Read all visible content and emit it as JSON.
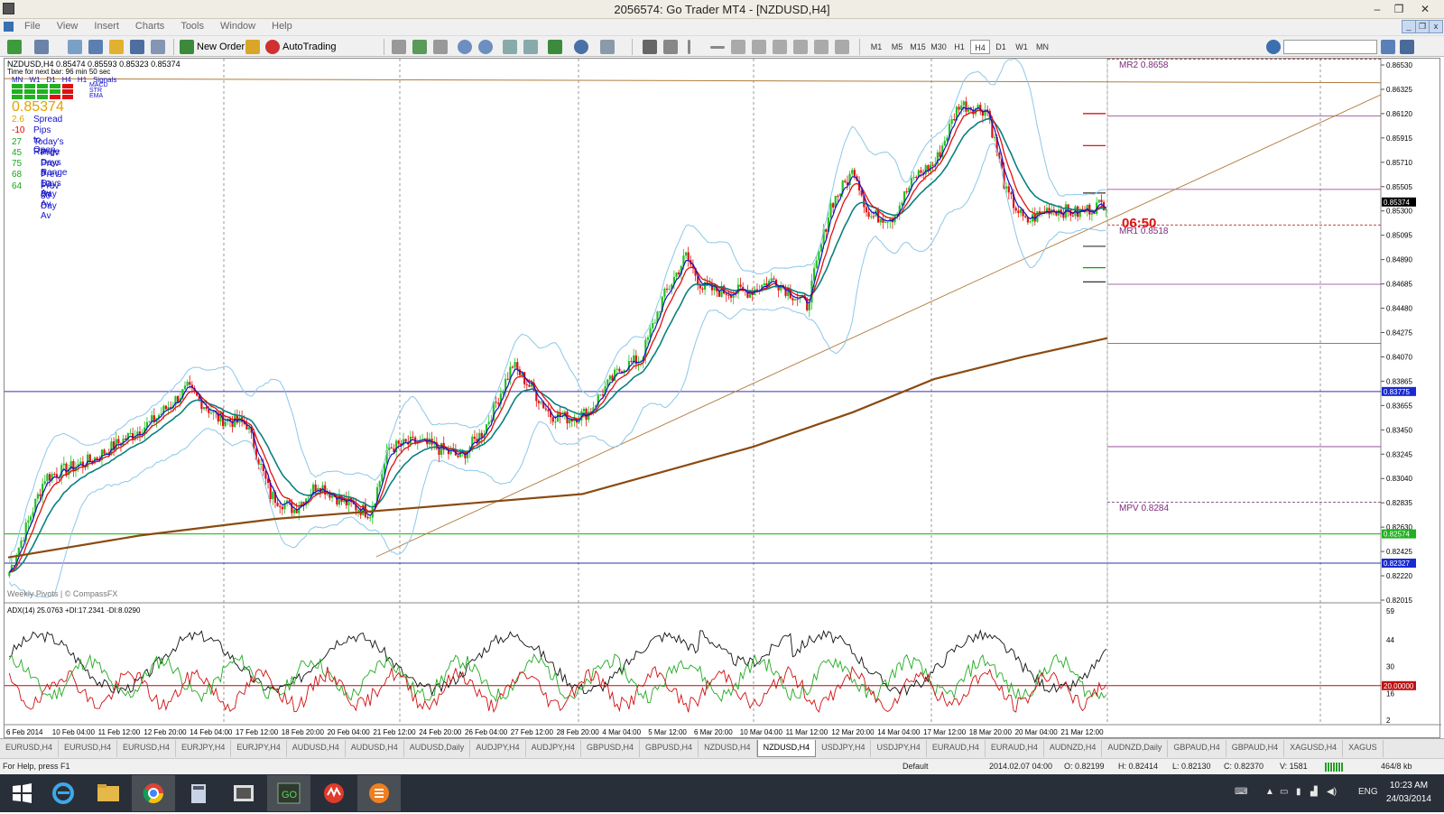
{
  "window": {
    "title": "2056574: Go Trader MT4 - [NZDUSD,H4]"
  },
  "menu": [
    "File",
    "View",
    "Insert",
    "Charts",
    "Tools",
    "Window",
    "Help"
  ],
  "toolbar": {
    "new_order": "New Order",
    "autotrading": "AutoTrading",
    "timeframes": [
      "M1",
      "M5",
      "M15",
      "M30",
      "H1",
      "H4",
      "D1",
      "W1",
      "MN"
    ],
    "active_timeframe": "H4"
  },
  "chart": {
    "symbol_line": "NZDUSD,H4  0.85474 0.85593 0.85323 0.85374",
    "time_to_bar": "Time for next bar: 96 min 50 sec",
    "signals_header": [
      "MN",
      "W1",
      "D1",
      "H4",
      "H1",
      "Signals"
    ],
    "signal_rows": [
      "MACD",
      "STR",
      "EMA"
    ],
    "price": "0.85374",
    "stats": [
      {
        "value": "2.6",
        "label": "Spread",
        "vcolor": "#e3a200",
        "lcolor": "#1414c8"
      },
      {
        "value": "-10",
        "label": "Pips to Open",
        "vcolor": "#e00000",
        "lcolor": "#1414c8"
      },
      {
        "value": "27",
        "label": "Today's Range",
        "vcolor": "#18a818",
        "lcolor": "#1414c8"
      },
      {
        "value": "45",
        "label": "Prev Days Range",
        "vcolor": "#18a818",
        "lcolor": "#1414c8"
      },
      {
        "value": "75",
        "label": "Prev 5 Days Av",
        "vcolor": "#18a818",
        "lcolor": "#1414c8"
      },
      {
        "value": "68",
        "label": "Prev 10 Day Av",
        "vcolor": "#18a818",
        "lcolor": "#1414c8"
      },
      {
        "value": "64",
        "label": "Prev 30 Day Av",
        "vcolor": "#18a818",
        "lcolor": "#1414c8"
      }
    ],
    "pivot_labels": {
      "mr2": "MR2  0.8658",
      "mr1": "MR1  0.8518",
      "mpv": "MPV  0.8284"
    },
    "countdown": "06:50",
    "watermark": "Weekly Pivots | © CompassFX",
    "price_ticks": [
      "0.86530",
      "0.86325",
      "0.86120",
      "0.85915",
      "0.85710",
      "0.85505",
      "0.85300",
      "0.85095",
      "0.84890",
      "0.84685",
      "0.84480",
      "0.84275",
      "0.84070",
      "0.83865",
      "0.83655",
      "0.83450",
      "0.83245",
      "0.83040",
      "0.82835",
      "0.82630",
      "0.82425",
      "0.82220",
      "0.82015"
    ],
    "price_tags": [
      {
        "text": "0.85374",
        "bg": "#000000",
        "value": 0.85374
      },
      {
        "text": "0.83775",
        "bg": "#1a2ad0",
        "value": 0.83775
      },
      {
        "text": "0.82574",
        "bg": "#22b022",
        "value": 0.82574
      },
      {
        "text": "0.82327",
        "bg": "#1a2ad0",
        "value": 0.82327
      }
    ],
    "adx_label": "ADX(14) 25.0763 +DI:17.2341 -DI:8.0290",
    "adx_ticks": [
      "59",
      "44",
      "30",
      "16",
      "2"
    ],
    "adx_tag": "20.00000",
    "time_ticks": [
      "6 Feb 2014",
      "10 Feb 04:00",
      "11 Feb 12:00",
      "12 Feb 20:00",
      "14 Feb 04:00",
      "17 Feb 12:00",
      "18 Feb 20:00",
      "20 Feb 04:00",
      "21 Feb 12:00",
      "24 Feb 20:00",
      "26 Feb 04:00",
      "27 Feb 12:00",
      "28 Feb 20:00",
      "4 Mar 04:00",
      "5 Mar 12:00",
      "6 Mar 20:00",
      "10 Mar 04:00",
      "11 Mar 12:00",
      "12 Mar 20:00",
      "14 Mar 04:00",
      "17 Mar 12:00",
      "18 Mar 20:00",
      "20 Mar 04:00",
      "21 Mar 12:00"
    ]
  },
  "tabs": [
    {
      "label": "EURUSD,H4"
    },
    {
      "label": "EURUSD,H4"
    },
    {
      "label": "EURUSD,H4"
    },
    {
      "label": "EURJPY,H4"
    },
    {
      "label": "EURJPY,H4"
    },
    {
      "label": "AUDUSD,H4"
    },
    {
      "label": "AUDUSD,H4"
    },
    {
      "label": "AUDUSD,Daily"
    },
    {
      "label": "AUDJPY,H4"
    },
    {
      "label": "AUDJPY,H4"
    },
    {
      "label": "GBPUSD,H4"
    },
    {
      "label": "GBPUSD,H4"
    },
    {
      "label": "NZDUSD,H4"
    },
    {
      "label": "NZDUSD,H4",
      "active": true
    },
    {
      "label": "USDJPY,H4"
    },
    {
      "label": "USDJPY,H4"
    },
    {
      "label": "EURAUD,H4"
    },
    {
      "label": "EURAUD,H4"
    },
    {
      "label": "AUDNZD,H4"
    },
    {
      "label": "AUDNZD,Daily"
    },
    {
      "label": "GBPAUD,H4"
    },
    {
      "label": "GBPAUD,H4"
    },
    {
      "label": "XAGUSD,H4"
    },
    {
      "label": "XAGUS"
    }
  ],
  "status": {
    "help": "For Help, press F1",
    "profile": "Default",
    "datetime": "2014.02.07 04:00",
    "open": "O: 0.82199",
    "high": "H: 0.82414",
    "low": "L: 0.82130",
    "close": "C: 0.82370",
    "volume": "V: 1581",
    "traffic": "464/8 kb"
  },
  "taskbar": {
    "lang": "ENG",
    "time": "10:23 AM",
    "date": "24/03/2014"
  }
}
